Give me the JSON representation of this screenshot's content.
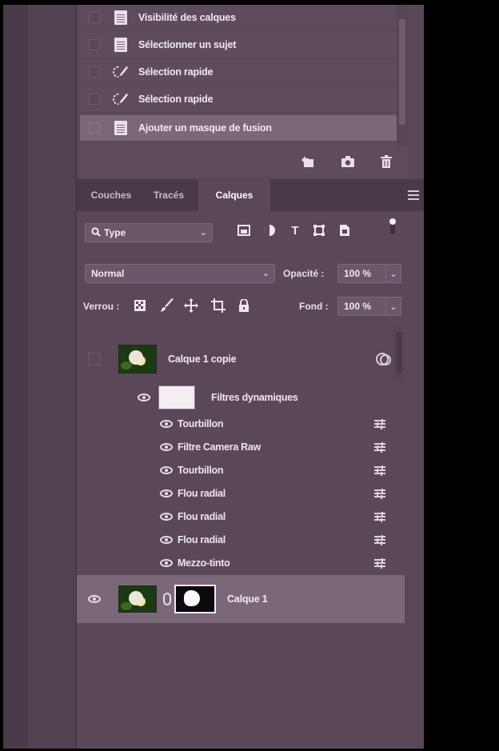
{
  "history": {
    "items": [
      {
        "label": "Visibilité des calques",
        "icon": "document-icon",
        "selected": false
      },
      {
        "label": "Sélectionner un sujet",
        "icon": "document-icon",
        "selected": false
      },
      {
        "label": "Sélection rapide",
        "icon": "quick-selection-brush-icon",
        "selected": false
      },
      {
        "label": "Sélection rapide",
        "icon": "quick-selection-brush-icon",
        "selected": false
      },
      {
        "label": "Ajouter un masque de fusion",
        "icon": "document-icon",
        "selected": true
      }
    ],
    "footer_icons": [
      "new-document-from-state-icon",
      "camera-snapshot-icon",
      "trash-icon"
    ]
  },
  "tabs": [
    {
      "label": "Couches",
      "active": false
    },
    {
      "label": "Tracés",
      "active": false
    },
    {
      "label": "Calques",
      "active": true
    }
  ],
  "filter": {
    "kind_value": "Type",
    "icons": [
      "image-filter-icon",
      "adjustment-filter-icon",
      "type-filter-icon",
      "shape-filter-icon",
      "smart-object-filter-icon",
      "filter-toggle-icon"
    ]
  },
  "blend": {
    "mode": "Normal",
    "opacity_label": "Opacité :",
    "opacity_value": "100 %"
  },
  "lock": {
    "label": "Verrou :",
    "icons": [
      "lock-transparent-pixels-icon",
      "lock-image-pixels-icon",
      "lock-position-icon",
      "lock-artboard-icon",
      "lock-all-icon"
    ],
    "fill_label": "Fond :",
    "fill_value": "100 %"
  },
  "layers": {
    "copy_layer": {
      "name": "Calque 1 copie",
      "visible": false
    },
    "smart_filters": {
      "name": "Filtres dynamiques"
    },
    "filters": [
      "Tourbillon",
      "Filtre Camera Raw",
      "Tourbillon",
      "Flou radial",
      "Flou radial",
      "Flou radial",
      "Mezzo-tinto"
    ],
    "base_layer": {
      "name": "Calque 1",
      "visible": true
    }
  },
  "colors": {
    "panel_bg": "#5a4858",
    "selected_row": "#7a6878",
    "tab_bar": "#4a3a48"
  }
}
